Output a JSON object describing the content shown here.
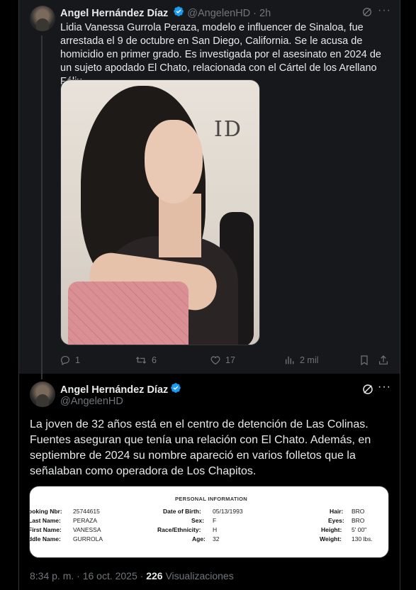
{
  "tweet1": {
    "author_name": "Angel Hernández Díaz",
    "handle": "@AngelenHD",
    "time": "2h",
    "separator": "·",
    "text": "Lidia Vanessa Gurrola Peraza, modelo e influencer de Sinaloa, fue arrestada el 9 de octubre en San Diego, California. Se le acusa de homicidio en primer grado. Es investigada por el asesinato en 2024 de un sujeto apodado El Chato, relacionada con el Cártel de los Arellano Félix.",
    "photo_logo": "ID",
    "actions": {
      "replies": "1",
      "reposts": "6",
      "likes": "17",
      "views": "2 mil"
    }
  },
  "tweet2": {
    "author_name": "Angel Hernández Díaz",
    "handle": "@AngelenHD",
    "text": "La joven de 32 años está en el centro de detención de Las Colinas. Fuentes aseguran que tenía una relación con El Chato. Además, en septiembre de 2024 su nombre apareció en varios folletos que la señalaban como operadora de Los Chapitos.",
    "document": {
      "title": "PERSONAL INFORMATION",
      "left_labels": [
        "ooking Nbr:",
        "Last Name:",
        "First Name:",
        "ddle Name:"
      ],
      "left_values": [
        "25744615",
        "PERAZA",
        "VANESSA",
        "GURROLA"
      ],
      "mid_labels": [
        "Date of Birth:",
        "Sex:",
        "Race/Ethnicity:",
        "Age:"
      ],
      "mid_values": [
        "05/13/1993",
        "F",
        "H",
        "32"
      ],
      "right_labels": [
        "Hair:",
        "Eyes:",
        "Height:",
        "Weight:"
      ],
      "right_values": [
        "BRO",
        "BRO",
        "5' 00\"",
        "130 lbs."
      ]
    },
    "timestamp": "8:34 p. m. · 16 oct. 2025 · ",
    "views_count": "226",
    "views_label": " Visualizaciones"
  },
  "colors": {
    "background": "#000000",
    "card": "#16181c",
    "text": "#e7e9ea",
    "muted": "#71767b",
    "verified": "#1d9bf0"
  }
}
